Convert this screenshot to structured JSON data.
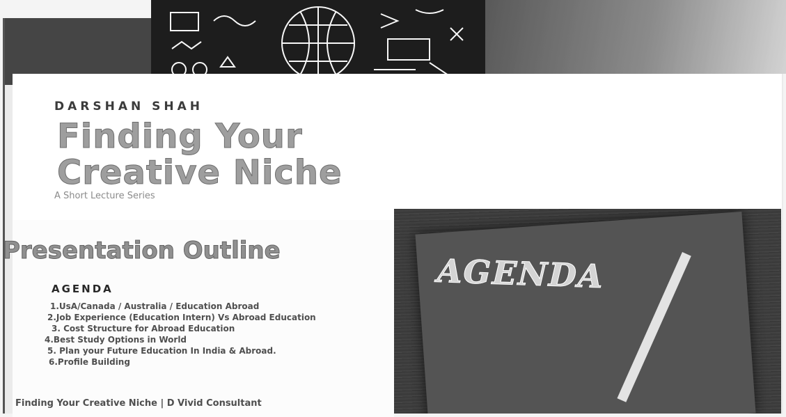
{
  "title_slide": {
    "author": "DARSHAN SHAH",
    "title_line1": "Finding Your",
    "title_line2": "Creative Niche",
    "subtitle": "A Short Lecture Series"
  },
  "outline_slide": {
    "heading": "Presentation Outline",
    "agenda_heading": "AGENDA",
    "items": [
      "1.UsA/Canada / Australia / Education Abroad",
      "2.Job Experience (Education Intern) Vs Abroad Education",
      "3. Cost Structure for Abroad Education",
      "4.Best Study Options in World",
      "5. Plan your Future Education In India & Abroad.",
      "6.Profile Building"
    ],
    "footer": "Finding Your Creative Niche | D Vivid Consultant"
  },
  "agenda_image": {
    "word": "AGENDA"
  }
}
